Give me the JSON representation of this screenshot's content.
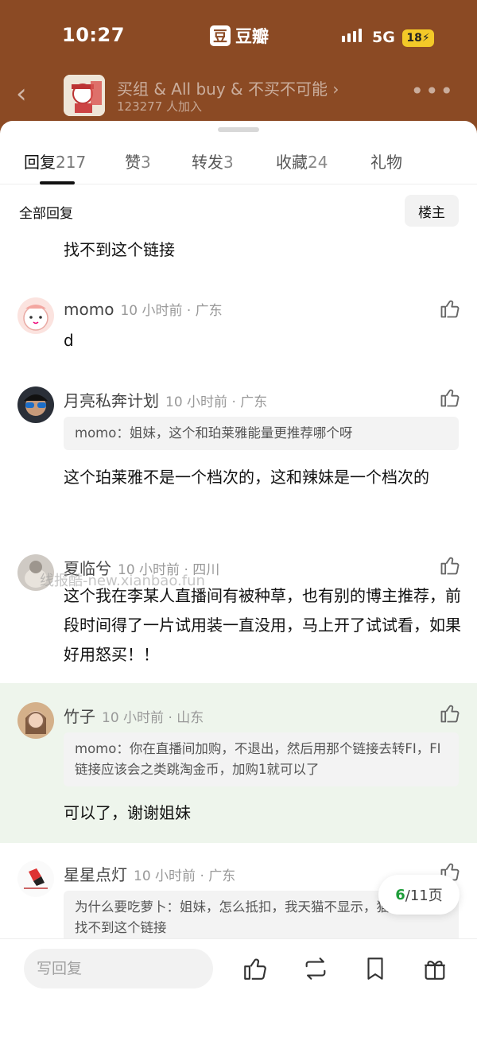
{
  "status": {
    "time": "10:27",
    "app_name": "豆瓣",
    "app_logo": "豆",
    "network": "5G",
    "battery": "18"
  },
  "group": {
    "name": "买组 & All buy & 不买不可能",
    "members": "123277 人加入",
    "back_icon": "chevron-left-icon",
    "more_icon": "more-icon"
  },
  "tabs": [
    {
      "label": "回复",
      "count": "217",
      "active": true
    },
    {
      "label": "赞",
      "count": "3"
    },
    {
      "label": "转发",
      "count": "3"
    },
    {
      "label": "收藏",
      "count": "24"
    },
    {
      "label": "礼物",
      "count": ""
    }
  ],
  "section": {
    "all_replies": "全部回复",
    "louzhu_button": "楼主"
  },
  "top_fragment": "找不到这个链接",
  "comments": [
    {
      "user": "momo",
      "meta": "10 小时前 · 广东",
      "quote": "",
      "text": "d"
    },
    {
      "user": "月亮私奔计划",
      "meta": "10 小时前 · 广东",
      "quote": "momo：姐妹，这个和珀莱雅能量更推荐哪个呀",
      "text": "这个珀莱雅不是一个档次的，这和辣妹是一个档次的"
    },
    {
      "user": "夏临兮",
      "meta": "10 小时前 · 四川",
      "quote": "",
      "text": "这个我在李某人直播间有被种草，也有别的博主推荐，前段时间得了一片试用装一直没用，马上开了试试看，如果好用怒买！！"
    },
    {
      "user": "竹子",
      "meta": "10 小时前 · 山东",
      "quote": "momo：你在直播间加购，不退出，然后用那个链接去转FI，FI链接应该会之类跳淘金币，加购1就可以了",
      "text": "可以了，谢谢姐妹"
    },
    {
      "user": "星星点灯",
      "meta": "10 小时前 · 广东",
      "quote": "为什么要吃萝卜：姐妹，怎么抵扣，我天猫不显示，猫猫币里也找不到这个链接",
      "text": ""
    }
  ],
  "watermark": "线报酷-new.xianbao.fun",
  "pager": {
    "current": "6",
    "total": "/11页"
  },
  "bottom": {
    "reply_placeholder": "写回复"
  },
  "colors": {
    "header_bg": "#8B4A24",
    "highlight_bg": "#eef5ec",
    "pager_current": "#1f9d3a"
  }
}
